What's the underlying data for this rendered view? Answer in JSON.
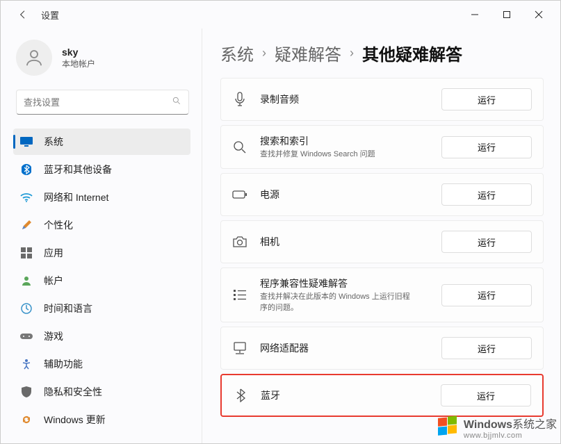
{
  "titlebar": {
    "title": "设置"
  },
  "profile": {
    "name": "sky",
    "sub": "本地帐户"
  },
  "search": {
    "placeholder": "查找设置"
  },
  "nav": {
    "items": [
      {
        "label": "系统"
      },
      {
        "label": "蓝牙和其他设备"
      },
      {
        "label": "网络和 Internet"
      },
      {
        "label": "个性化"
      },
      {
        "label": "应用"
      },
      {
        "label": "帐户"
      },
      {
        "label": "时间和语言"
      },
      {
        "label": "游戏"
      },
      {
        "label": "辅助功能"
      },
      {
        "label": "隐私和安全性"
      },
      {
        "label": "Windows 更新"
      }
    ]
  },
  "breadcrumb": {
    "c1": "系统",
    "c2": "疑难解答",
    "c3": "其他疑难解答"
  },
  "run_label": "运行",
  "ts": {
    "items": [
      {
        "title": "录制音频",
        "desc": ""
      },
      {
        "title": "搜索和索引",
        "desc": "查找并修复 Windows Search 问题"
      },
      {
        "title": "电源",
        "desc": ""
      },
      {
        "title": "相机",
        "desc": ""
      },
      {
        "title": "程序兼容性疑难解答",
        "desc": "查找并解决在此版本的 Windows 上运行旧程序的问题。"
      },
      {
        "title": "网络适配器",
        "desc": ""
      },
      {
        "title": "蓝牙",
        "desc": ""
      }
    ]
  },
  "watermark": {
    "brand": "Windows",
    "suffix": "系统之家",
    "url": "www.bjjmlv.com"
  }
}
